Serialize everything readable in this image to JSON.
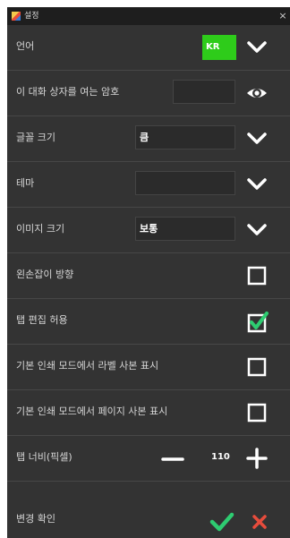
{
  "window": {
    "title": "설정",
    "close_glyph": "×"
  },
  "rows": [
    {
      "label": "언어",
      "value": "KR",
      "control": "chevron-down-icon"
    },
    {
      "label": "이 대화 상자를 여는 암호",
      "value": "",
      "control": "eye-icon"
    },
    {
      "label": "글꼴 크기",
      "value": "큼",
      "control": "chevron-down-icon"
    },
    {
      "label": "테마",
      "value": "",
      "control": "chevron-down-icon"
    },
    {
      "label": "이미지 크기",
      "value": "보통",
      "control": "chevron-down-icon"
    },
    {
      "label": "왼손잡이 방향",
      "checked": false,
      "control": "checkbox"
    },
    {
      "label": "탭 편집 허용",
      "checked": true,
      "control": "checkbox"
    },
    {
      "label": "기본 인쇄 모드에서 라벨 사본 표시",
      "checked": false,
      "control": "checkbox"
    },
    {
      "label": "기본 인쇄 모드에서 페이지 사본 표시",
      "checked": false,
      "control": "checkbox"
    },
    {
      "label": "탭 너비(픽셀)",
      "value": "110",
      "control": "stepper"
    }
  ],
  "footer": {
    "label": "변경 확인"
  },
  "colors": {
    "background": "#333333",
    "accent_green": "#2ecc1a",
    "check_green": "#2ecc71",
    "cancel_red": "#e74c3c"
  }
}
